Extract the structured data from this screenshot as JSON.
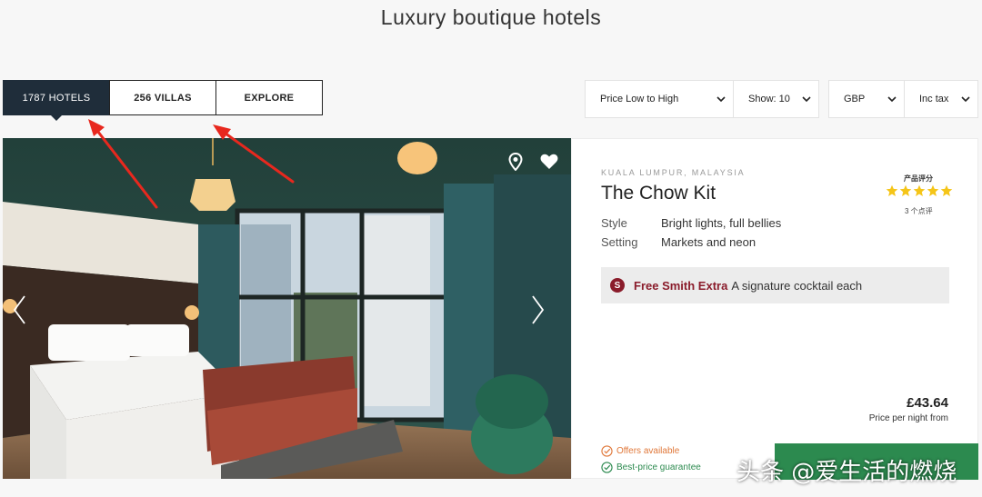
{
  "page": {
    "title": "Luxury boutique hotels"
  },
  "tabs": [
    {
      "label": "1787 HOTELS",
      "active": true
    },
    {
      "label": "256 VILLAS",
      "active": false
    },
    {
      "label": "EXPLORE",
      "active": false
    }
  ],
  "filters": {
    "sort": "Price Low to High",
    "show": "Show: 10",
    "currency": "GBP",
    "tax": "Inc tax"
  },
  "hotel": {
    "location": "KUALA LUMPUR, MALAYSIA",
    "name": "The Chow Kit",
    "style_label": "Style",
    "style_value": "Bright lights, full bellies",
    "setting_label": "Setting",
    "setting_value": "Markets and neon",
    "rating_title": "产品评分",
    "rating_stars": 5,
    "reviews": "3 个点评",
    "perk_badge": "S",
    "perk_title": "Free Smith Extra",
    "perk_text": "A signature cocktail each",
    "price": "£43.64",
    "price_note": "Price per night from",
    "offers": "Offers available",
    "guarantee": "Best-price guarantee"
  },
  "icons": {
    "map": "map-pin-icon",
    "favorite": "heart-icon",
    "prev": "chevron-left-icon",
    "next": "chevron-right-icon"
  },
  "colors": {
    "active_tab": "#1f2d3a",
    "star": "#f5c518",
    "perk": "#8a1c2b",
    "offers": "#e0783a",
    "guarantee": "#2c8a4f",
    "book_button": "#2c8a4f"
  },
  "watermark": "头条 @爱生活的燃烧"
}
